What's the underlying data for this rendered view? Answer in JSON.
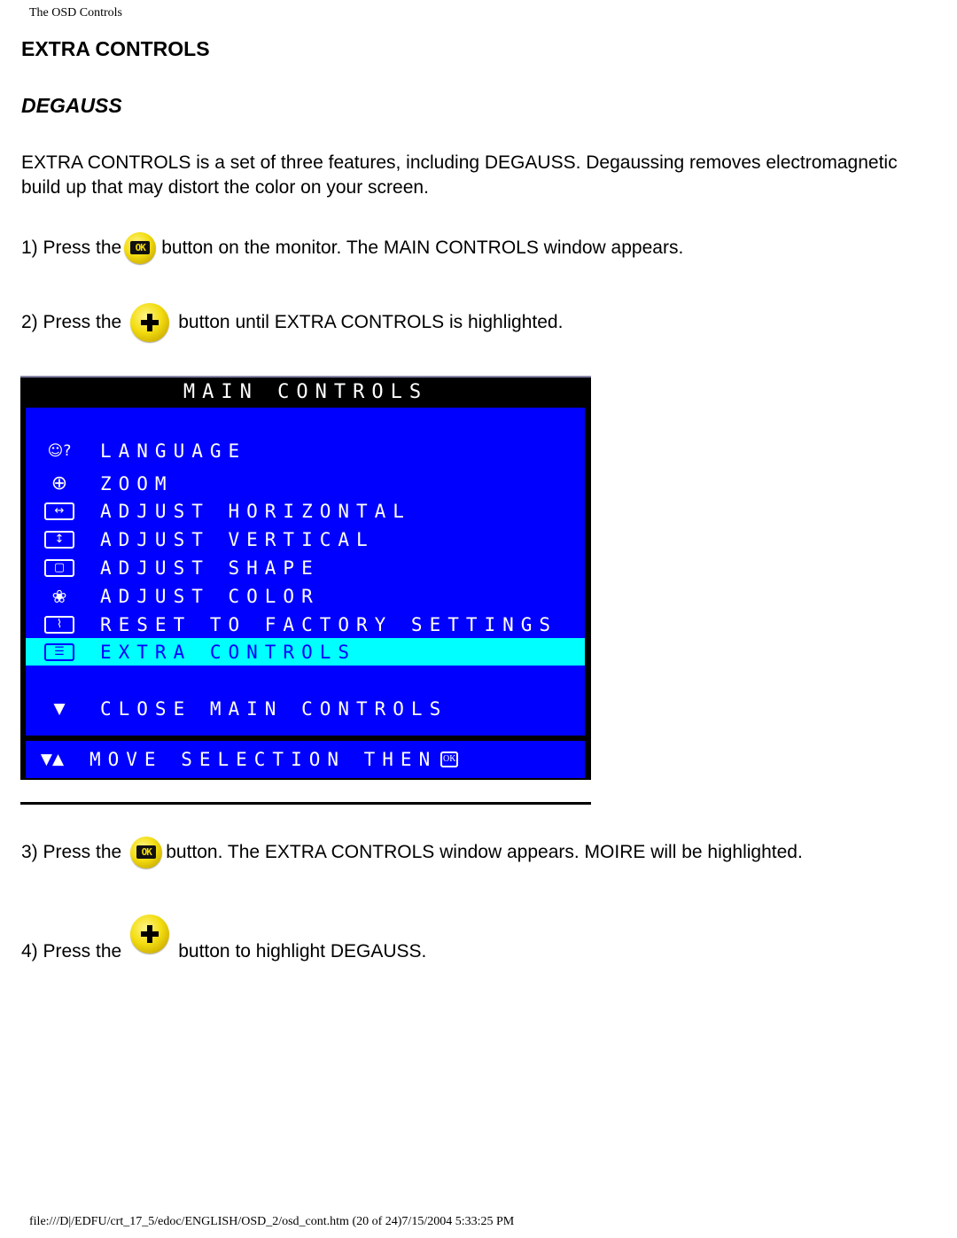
{
  "page": {
    "header": "The OSD Controls",
    "title": "EXTRA CONTROLS",
    "subtitle": "DEGAUSS",
    "intro": "EXTRA CONTROLS is a set of three features, including DEGAUSS. Degaussing removes electromagnetic build up that may distort the color on your screen.",
    "footer": "file:///D|/EDFU/crt_17_5/edoc/ENGLISH/OSD_2/osd_cont.htm (20 of 24)7/15/2004 5:33:25 PM"
  },
  "steps": [
    {
      "prefix": "1) Press the",
      "icon": "ok-button-icon",
      "suffix": "button on the monitor. The MAIN CONTROLS window appears."
    },
    {
      "prefix": "2) Press the",
      "icon": "plus-button-icon",
      "suffix": "button until EXTRA CONTROLS is highlighted."
    },
    {
      "prefix": "3) Press the",
      "icon": "ok-button-icon",
      "suffix": "button. The EXTRA CONTROLS window appears. MOIRE will be highlighted."
    },
    {
      "prefix": "4) Press the",
      "icon": "plus-button-icon",
      "suffix": "button to highlight DEGAUSS."
    }
  ],
  "button_icons": {
    "ok_label": "OK",
    "plus_label": "+"
  },
  "osd": {
    "title": "MAIN CONTROLS",
    "colors": {
      "panel": "#0000ff",
      "highlight": "#00ffff",
      "frame": "#000000",
      "text": "#ffffff"
    },
    "items": [
      {
        "label": "LANGUAGE",
        "icon": "language-icon",
        "glyph": "☺?"
      },
      {
        "label": "ZOOM",
        "icon": "zoom-icon",
        "glyph": "⊕"
      },
      {
        "label": "ADJUST HORIZONTAL",
        "icon": "horizontal-arrows-icon",
        "glyph": "↔"
      },
      {
        "label": "ADJUST VERTICAL",
        "icon": "vertical-arrows-icon",
        "glyph": "↕"
      },
      {
        "label": "ADJUST SHAPE",
        "icon": "shape-icon",
        "glyph": "▢"
      },
      {
        "label": "ADJUST COLOR",
        "icon": "palette-icon",
        "glyph": "❀"
      },
      {
        "label": "RESET TO FACTORY SETTINGS",
        "icon": "factory-icon",
        "glyph": "⌇"
      },
      {
        "label": "EXTRA CONTROLS",
        "icon": "extra-controls-icon",
        "glyph": "☰",
        "selected": true
      }
    ],
    "close": {
      "label": "CLOSE MAIN CONTROLS",
      "icon": "down-arrow-icon",
      "glyph": "▼"
    },
    "footer": {
      "label": "MOVE SELECTION THEN",
      "icon": "up-down-arrows-icon",
      "glyph": "▼▲",
      "end_glyph": "OK"
    }
  }
}
